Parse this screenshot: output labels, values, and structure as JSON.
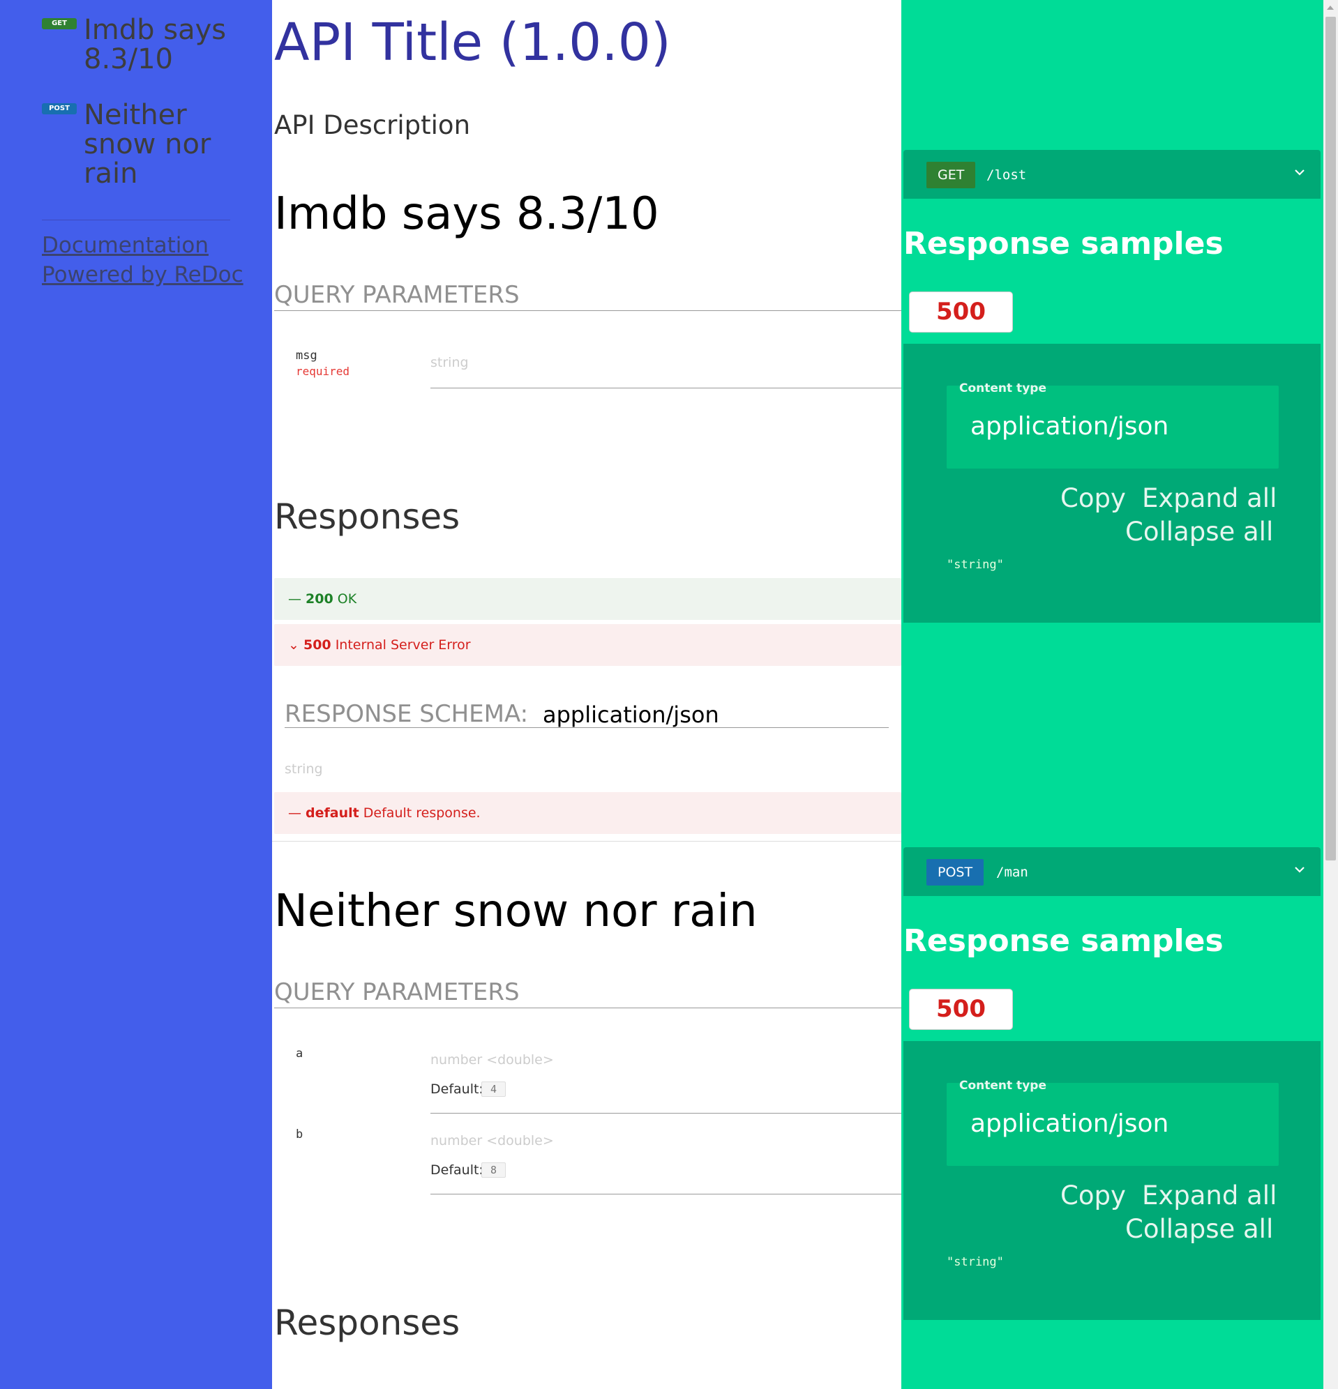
{
  "sidebar": {
    "items": [
      {
        "method": "GET",
        "label": "Imdb says 8.3/10"
      },
      {
        "method": "POST",
        "label": "Neither snow nor rain"
      }
    ],
    "links": [
      "Documentation",
      "Powered by ReDoc"
    ]
  },
  "main": {
    "api_title": "API Title (1.0.0)",
    "api_description": "API Description",
    "operations": [
      {
        "title": "Imdb says 8.3/10",
        "query_params_label": "QUERY PARAMETERS",
        "params": [
          {
            "name": "msg",
            "required": "required",
            "type": "string"
          }
        ],
        "responses_label": "Responses",
        "responses": [
          {
            "prefix": "—",
            "code": "200",
            "text": "OK"
          },
          {
            "prefix": "⌄",
            "code": "500",
            "text": "Internal Server Error"
          },
          {
            "prefix": "—",
            "code": "default",
            "text": "Default response."
          }
        ],
        "schema_label": "RESPONSE SCHEMA:",
        "schema_content_type": "application/json",
        "schema_type": "string"
      },
      {
        "title": "Neither snow nor rain",
        "query_params_label": "QUERY PARAMETERS",
        "params": [
          {
            "name": "a",
            "type": "number <double>",
            "default_label": "Default:",
            "default": "4"
          },
          {
            "name": "b",
            "type": "number <double>",
            "default_label": "Default:",
            "default": "8"
          }
        ],
        "responses_label": "Responses"
      }
    ]
  },
  "right_panel": {
    "endpoints": [
      {
        "method": "GET",
        "path": "/lost",
        "samples_title": "Response samples",
        "status_tab": "500",
        "content_type_label": "Content type",
        "content_type": "application/json",
        "copy": "Copy",
        "expand_all": "Expand all",
        "collapse_all": "Collapse all",
        "code": "\"string\""
      },
      {
        "method": "POST",
        "path": "/man",
        "samples_title": "Response samples",
        "status_tab": "500",
        "content_type_label": "Content type",
        "content_type": "application/json",
        "copy": "Copy",
        "expand_all": "Expand all",
        "collapse_all": "Collapse all",
        "code": "\"string\""
      }
    ]
  },
  "colors": {
    "sidebar_bg": "#435eeb",
    "right_bg": "#00dc97",
    "panel_dark": "#00a976",
    "title": "#32329f",
    "get": "#2f8132",
    "post": "#186fb0",
    "error": "#d41f1c",
    "success": "#1d8127"
  }
}
